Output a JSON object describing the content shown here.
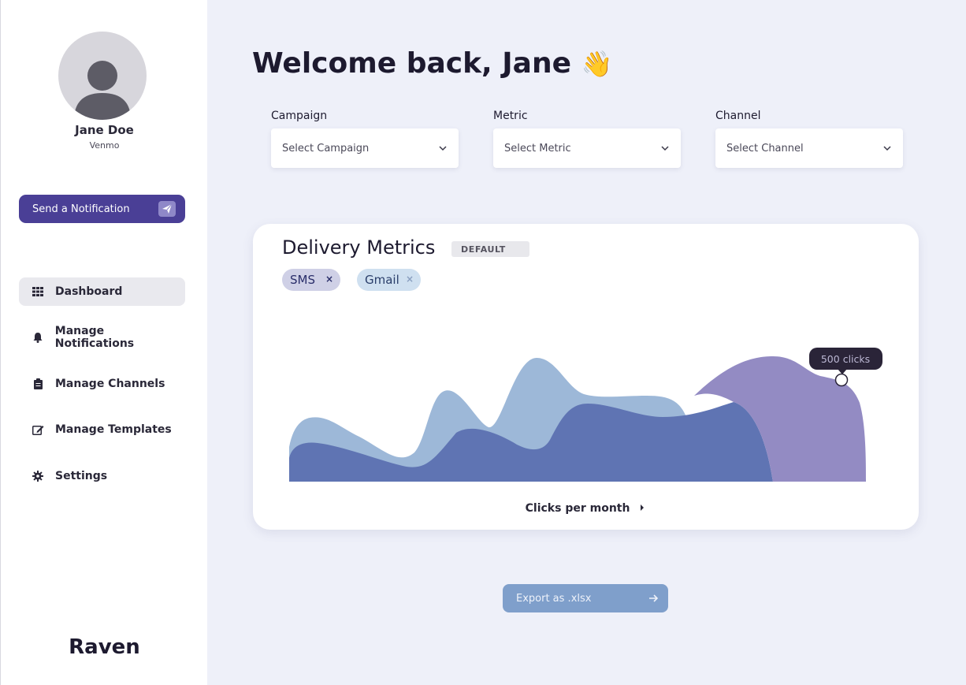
{
  "user": {
    "name": "Jane Doe",
    "org": "Venmo"
  },
  "sidebar": {
    "notify_button": "Send a Notification",
    "items": [
      {
        "label": "Dashboard",
        "icon": "grid-icon",
        "active": true
      },
      {
        "label": "Manage Notifications",
        "icon": "bell-icon"
      },
      {
        "label": "Manage Channels",
        "icon": "clipboard-icon"
      },
      {
        "label": "Manage Templates",
        "icon": "edit-icon"
      },
      {
        "label": "Settings",
        "icon": "gear-icon"
      }
    ],
    "brand": "Raven"
  },
  "header": {
    "welcome": "Welcome back, Jane",
    "emoji": "👋"
  },
  "filters": [
    {
      "label": "Campaign",
      "placeholder": "Select Campaign"
    },
    {
      "label": "Metric",
      "placeholder": "Select Metric"
    },
    {
      "label": "Channel",
      "placeholder": "Select Channel"
    }
  ],
  "card": {
    "title": "Delivery Metrics",
    "badge": "DEFAULT",
    "chips": [
      {
        "label": "SMS",
        "remove": "×"
      },
      {
        "label": "Gmail",
        "remove": "×"
      }
    ],
    "tooltip": "500 clicks",
    "x_label": "Clicks per month"
  },
  "export_button": "Export as .xlsx",
  "colors": {
    "primary": "#4a3f96",
    "series_gmail": "#9db8d8",
    "series_sms": "#5f74b3",
    "series_purple": "#938bc3",
    "background": "#eef0f9"
  }
}
